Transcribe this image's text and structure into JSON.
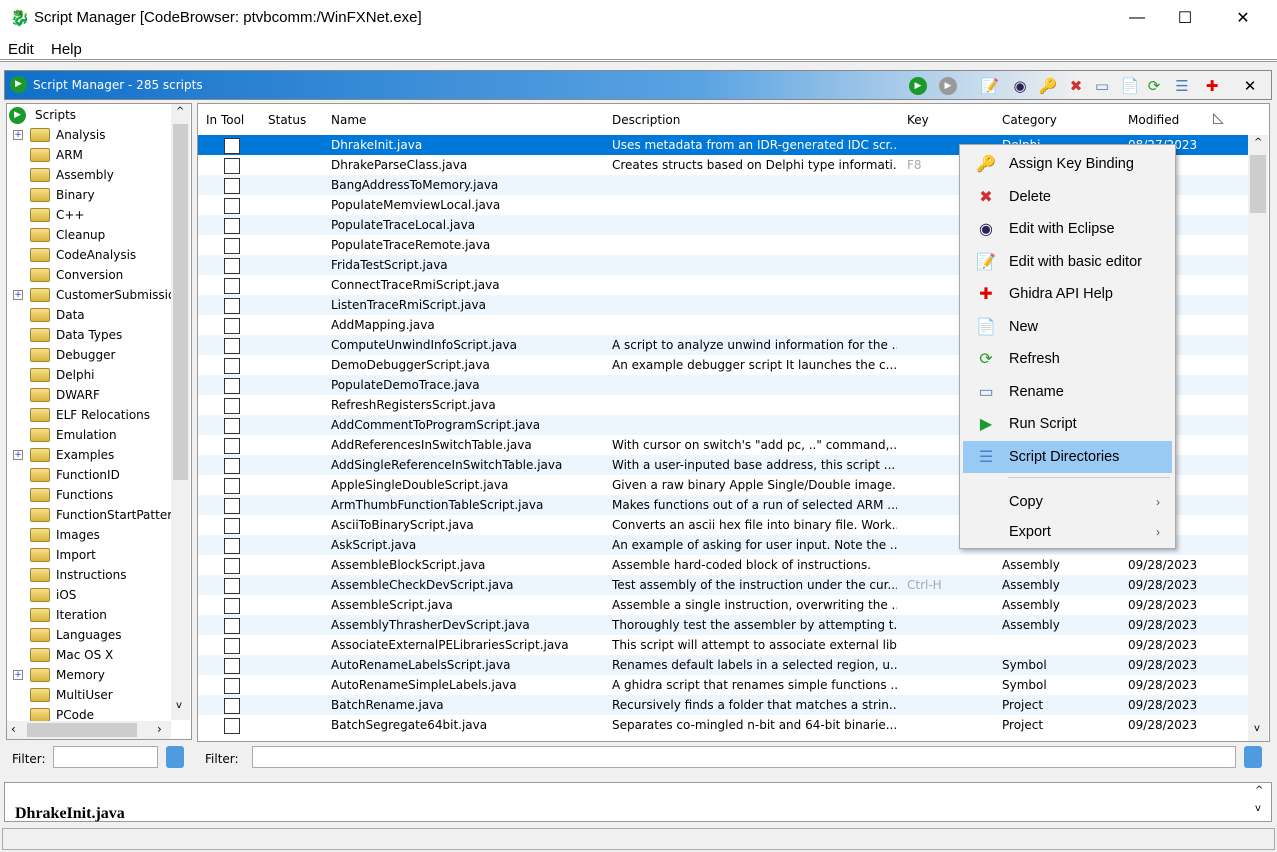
{
  "window": {
    "title": "Script Manager [CodeBrowser: ptvbcomm:/WinFXNet.exe]",
    "minimize": "—",
    "maximize": "☐",
    "close": "✕"
  },
  "menubar": {
    "edit": "Edit",
    "help": "Help"
  },
  "header": {
    "title": "Script Manager - 285 scripts"
  },
  "toolbar": [
    "run-icon",
    "run-last-icon",
    "edit-basic-icon",
    "eclipse-icon",
    "key-icon",
    "delete-icon",
    "rename-icon",
    "new-icon",
    "refresh-icon",
    "script-directories-icon",
    "help-icon",
    "close-icon"
  ],
  "tree": {
    "root": "Scripts",
    "items": [
      {
        "label": "Analysis",
        "expandable": true
      },
      {
        "label": "ARM"
      },
      {
        "label": "Assembly"
      },
      {
        "label": "Binary"
      },
      {
        "label": "C++"
      },
      {
        "label": "Cleanup"
      },
      {
        "label": "CodeAnalysis"
      },
      {
        "label": "Conversion"
      },
      {
        "label": "CustomerSubmission",
        "expandable": true
      },
      {
        "label": "Data"
      },
      {
        "label": "Data Types"
      },
      {
        "label": "Debugger"
      },
      {
        "label": "Delphi"
      },
      {
        "label": "DWARF"
      },
      {
        "label": "ELF Relocations"
      },
      {
        "label": "Emulation"
      },
      {
        "label": "Examples",
        "expandable": true
      },
      {
        "label": "FunctionID"
      },
      {
        "label": "Functions"
      },
      {
        "label": "FunctionStartPatterns"
      },
      {
        "label": "Images"
      },
      {
        "label": "Import"
      },
      {
        "label": "Instructions"
      },
      {
        "label": "iOS"
      },
      {
        "label": "Iteration"
      },
      {
        "label": "Languages"
      },
      {
        "label": "Mac OS X"
      },
      {
        "label": "Memory",
        "expandable": true
      },
      {
        "label": "MultiUser"
      },
      {
        "label": "PCode"
      }
    ]
  },
  "table": {
    "columns": {
      "in_tool": "In Tool",
      "status": "Status",
      "name": "Name",
      "description": "Description",
      "key": "Key",
      "category": "Category",
      "modified": "Modified"
    },
    "rows": [
      {
        "name": "DhrakeInit.java",
        "description": "Uses metadata from an IDR-generated IDC scr...",
        "key": "",
        "category": "Delphi",
        "modified": "08/27/2023"
      },
      {
        "name": "DhrakeParseClass.java",
        "description": "Creates structs based on Delphi type informati...",
        "key": "F8",
        "category": "",
        "modified": ""
      },
      {
        "name": "BangAddressToMemory.java",
        "description": "",
        "key": "",
        "category": "",
        "modified": ""
      },
      {
        "name": "PopulateMemviewLocal.java",
        "description": "",
        "key": "",
        "category": "",
        "modified": ""
      },
      {
        "name": "PopulateTraceLocal.java",
        "description": "",
        "key": "",
        "category": "",
        "modified": ""
      },
      {
        "name": "PopulateTraceRemote.java",
        "description": "",
        "key": "",
        "category": "",
        "modified": ""
      },
      {
        "name": "FridaTestScript.java",
        "description": "",
        "key": "",
        "category": "",
        "modified": ""
      },
      {
        "name": "ConnectTraceRmiScript.java",
        "description": "",
        "key": "",
        "category": "",
        "modified": ""
      },
      {
        "name": "ListenTraceRmiScript.java",
        "description": "",
        "key": "",
        "category": "",
        "modified": ""
      },
      {
        "name": "AddMapping.java",
        "description": "",
        "key": "",
        "category": "",
        "modified": ""
      },
      {
        "name": "ComputeUnwindInfoScript.java",
        "description": "A script to analyze unwind information for the ...",
        "key": "",
        "category": "",
        "modified": ""
      },
      {
        "name": "DemoDebuggerScript.java",
        "description": "An example debugger script It launches the c...",
        "key": "",
        "category": "",
        "modified": ""
      },
      {
        "name": "PopulateDemoTrace.java",
        "description": "",
        "key": "",
        "category": "",
        "modified": ""
      },
      {
        "name": "RefreshRegistersScript.java",
        "description": "",
        "key": "",
        "category": "",
        "modified": ""
      },
      {
        "name": "AddCommentToProgramScript.java",
        "description": "",
        "key": "",
        "category": "",
        "modified": ""
      },
      {
        "name": "AddReferencesInSwitchTable.java",
        "description": "With cursor on switch's \"add pc, ..\" command,...",
        "key": "",
        "category": "",
        "modified": ""
      },
      {
        "name": "AddSingleReferenceInSwitchTable.java",
        "description": "With a user-inputed base address, this script ...",
        "key": "",
        "category": "",
        "modified": ""
      },
      {
        "name": "AppleSingleDoubleScript.java",
        "description": "Given a raw binary Apple Single/Double image...",
        "key": "",
        "category": "",
        "modified": ""
      },
      {
        "name": "ArmThumbFunctionTableScript.java",
        "description": "Makes functions out of a run of selected ARM ...",
        "key": "",
        "category": "",
        "modified": ""
      },
      {
        "name": "AsciiToBinaryScript.java",
        "description": "Converts an ascii hex file into binary file. Work...",
        "key": "",
        "category": "",
        "modified": ""
      },
      {
        "name": "AskScript.java",
        "description": "An example of asking for user input. Note the ...",
        "key": "",
        "category": "",
        "modified": ""
      },
      {
        "name": "AssembleBlockScript.java",
        "description": "Assemble hard-coded block of instructions.",
        "key": "",
        "category": "Assembly",
        "modified": "09/28/2023"
      },
      {
        "name": "AssembleCheckDevScript.java",
        "description": "Test assembly of the instruction under the cur...",
        "key": "Ctrl-H",
        "category": "Assembly",
        "modified": "09/28/2023"
      },
      {
        "name": "AssembleScript.java",
        "description": "Assemble a single instruction, overwriting the ...",
        "key": "",
        "category": "Assembly",
        "modified": "09/28/2023"
      },
      {
        "name": "AssemblyThrasherDevScript.java",
        "description": "Thoroughly test the assembler by attempting t...",
        "key": "",
        "category": "Assembly",
        "modified": "09/28/2023"
      },
      {
        "name": "AssociateExternalPELibrariesScript.java",
        "description": "This script will attempt to associate external lib...",
        "key": "",
        "category": "",
        "modified": "09/28/2023"
      },
      {
        "name": "AutoRenameLabelsScript.java",
        "description": "Renames default labels in a selected region, u...",
        "key": "",
        "category": "Symbol",
        "modified": "09/28/2023"
      },
      {
        "name": "AutoRenameSimpleLabels.java",
        "description": "A ghidra script that renames simple functions ...",
        "key": "",
        "category": "Symbol",
        "modified": "09/28/2023"
      },
      {
        "name": "BatchRename.java",
        "description": "Recursively finds a folder that matches a strin...",
        "key": "",
        "category": "Project",
        "modified": "09/28/2023"
      },
      {
        "name": "BatchSegregate64bit.java",
        "description": "Separates co-mingled n-bit and 64-bit binarie...",
        "key": "",
        "category": "Project",
        "modified": "09/28/2023"
      }
    ]
  },
  "filters": {
    "tree_label": "Filter:",
    "tree_value": "",
    "table_label": "Filter:",
    "table_value": ""
  },
  "bottom": {
    "selected_script": "DhrakeInit.java"
  },
  "context_menu": [
    {
      "label": "Assign Key Binding",
      "icon": "key-icon"
    },
    {
      "label": "Delete",
      "icon": "delete-icon"
    },
    {
      "label": "Edit with Eclipse",
      "icon": "eclipse-icon"
    },
    {
      "label": "Edit with basic editor",
      "icon": "edit-basic-icon"
    },
    {
      "label": "Ghidra API Help",
      "icon": "help-icon"
    },
    {
      "label": "New",
      "icon": "new-icon"
    },
    {
      "label": "Refresh",
      "icon": "refresh-icon"
    },
    {
      "label": "Rename",
      "icon": "rename-icon"
    },
    {
      "label": "Run Script",
      "icon": "run-icon"
    },
    {
      "label": "Script Directories",
      "icon": "script-directories-icon",
      "highlighted": true
    },
    {
      "label": "Copy",
      "submenu": true
    },
    {
      "label": "Export",
      "submenu": true
    }
  ],
  "colors": {
    "selection": "#0078d7",
    "menu_highlight": "#99c9f5",
    "header_gradient_start": "#0f6fc9"
  }
}
